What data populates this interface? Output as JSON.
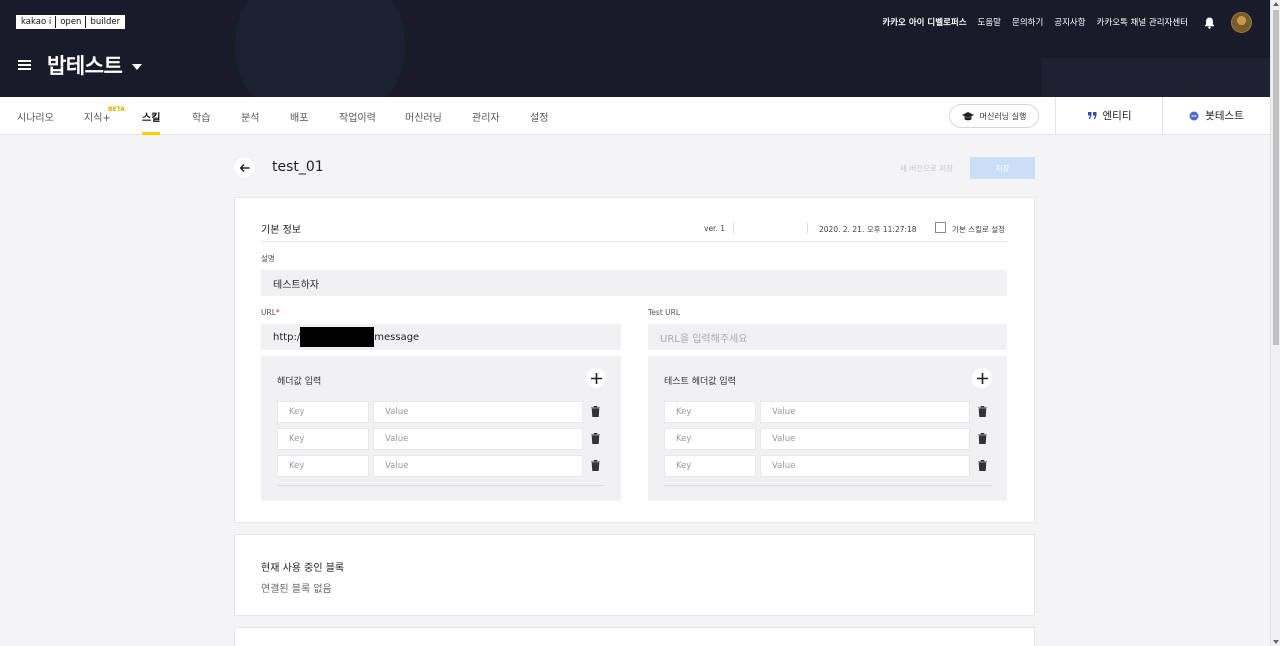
{
  "header": {
    "logo": [
      "kakao i",
      "open",
      "builder"
    ],
    "bot_name": "밥테스트",
    "links": [
      "카카오 아이 디벨로퍼스",
      "도움말",
      "문의하기",
      "공지사항",
      "카카오톡 채널 관리자센터"
    ]
  },
  "nav": {
    "tabs": [
      "시나리오",
      "지식+",
      "스킬",
      "학습",
      "분석",
      "배포",
      "작업이력",
      "머신러닝",
      "관리자",
      "설정"
    ],
    "beta_badge": "BETA",
    "active_tab": "스킬",
    "ml_button": "머신러닝 실행",
    "entity": "엔티티",
    "bottest": "봇테스트"
  },
  "page": {
    "title": "test_01",
    "save_as_new": "새 버전으로 저장",
    "save": "저장"
  },
  "basic_info": {
    "title": "기본 정보",
    "version": "ver. 1",
    "datetime": "2020. 2. 21. 오후 11:27:18",
    "default_skill_label": "기본 스킬로 설정",
    "default_skill_checked": false,
    "desc_label": "설명",
    "desc_value": "테스트하자",
    "url_label": "URL",
    "url_prefix": "http:/",
    "url_suffix": "message",
    "test_url_label": "Test URL",
    "test_url_placeholder": "URL을 입력해주세요"
  },
  "headers": {
    "title": "헤더값 입력",
    "test_title": "테스트 헤더값 입력",
    "key_placeholder": "Key",
    "value_placeholder": "Value",
    "rows": 3
  },
  "blocks": {
    "title": "현재 사용 중인 블록",
    "empty": "연결된 블록 없음"
  },
  "colors": {
    "header_bg": "#171b2a",
    "accent_yellow": "#ffcd00",
    "save_btn": "#c9dff8",
    "required": "#e02020"
  }
}
